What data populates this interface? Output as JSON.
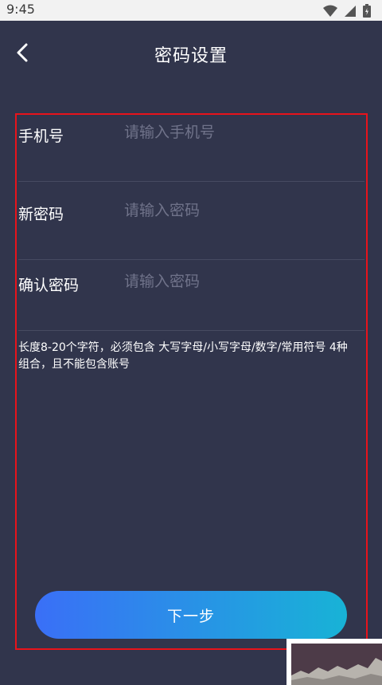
{
  "status_bar": {
    "time": "9:45",
    "icons": [
      "wifi-icon",
      "signal-icon",
      "battery-icon"
    ]
  },
  "header": {
    "title": "密码设置",
    "back_icon": "chevron-left-icon"
  },
  "form": {
    "fields": [
      {
        "label": "手机号",
        "placeholder": "请输入手机号",
        "value": ""
      },
      {
        "label": "新密码",
        "placeholder": "请输入密码",
        "value": ""
      },
      {
        "label": "确认密码",
        "placeholder": "请输入密码",
        "value": ""
      }
    ],
    "hint": "长度8-20个字符，必须包含 大写字母/小写字母/数字/常用符号 4种组合，且不能包含账号"
  },
  "next_button": {
    "label": "下一步"
  },
  "colors": {
    "background": "#31354c",
    "status_bar": "#f2f2f2",
    "highlight_border": "#e8131b",
    "placeholder": "#70738a",
    "divider": "#474b61",
    "button_gradient_start": "#3a6ff7",
    "button_gradient_end": "#18b3d6"
  }
}
